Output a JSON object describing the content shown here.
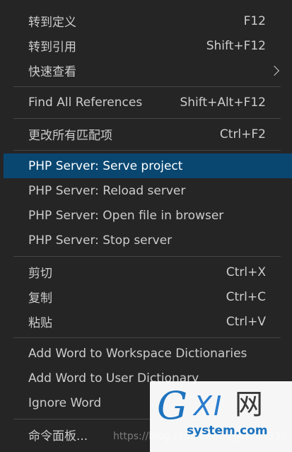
{
  "menu": {
    "group1": [
      {
        "label": "转到定义",
        "shortcut": "F12"
      },
      {
        "label": "转到引用",
        "shortcut": "Shift+F12"
      },
      {
        "label": "快速查看",
        "shortcut": ""
      }
    ],
    "group2": [
      {
        "label": "Find All References",
        "shortcut": "Shift+Alt+F12"
      }
    ],
    "group3": [
      {
        "label": "更改所有匹配项",
        "shortcut": "Ctrl+F2"
      }
    ],
    "group4": [
      {
        "label": "PHP Server: Serve project",
        "shortcut": "",
        "highlighted": true
      },
      {
        "label": "PHP Server: Reload server",
        "shortcut": ""
      },
      {
        "label": "PHP Server: Open file in browser",
        "shortcut": ""
      },
      {
        "label": "PHP Server: Stop server",
        "shortcut": ""
      }
    ],
    "group5": [
      {
        "label": "剪切",
        "shortcut": "Ctrl+X"
      },
      {
        "label": "复制",
        "shortcut": "Ctrl+C"
      },
      {
        "label": "粘贴",
        "shortcut": "Ctrl+V"
      }
    ],
    "group6": [
      {
        "label": "Add Word to Workspace Dictionaries",
        "shortcut": ""
      },
      {
        "label": "Add Word to User Dictionary",
        "shortcut": ""
      },
      {
        "label": "Ignore Word",
        "shortcut": ""
      }
    ],
    "group7": [
      {
        "label": "命令面板...",
        "shortcut": ""
      }
    ]
  },
  "watermark": {
    "url": "https://blog.csdn.net/qq_44803335",
    "logo_g": "G",
    "logo_xi": "XI",
    "logo_wang": "网",
    "logo_domain": "system.com"
  },
  "colors": {
    "menu_bg": "#252526",
    "highlight_bg": "#094771",
    "text": "#cccccc",
    "separator": "#454545",
    "logo_blue": "#1e73be"
  }
}
